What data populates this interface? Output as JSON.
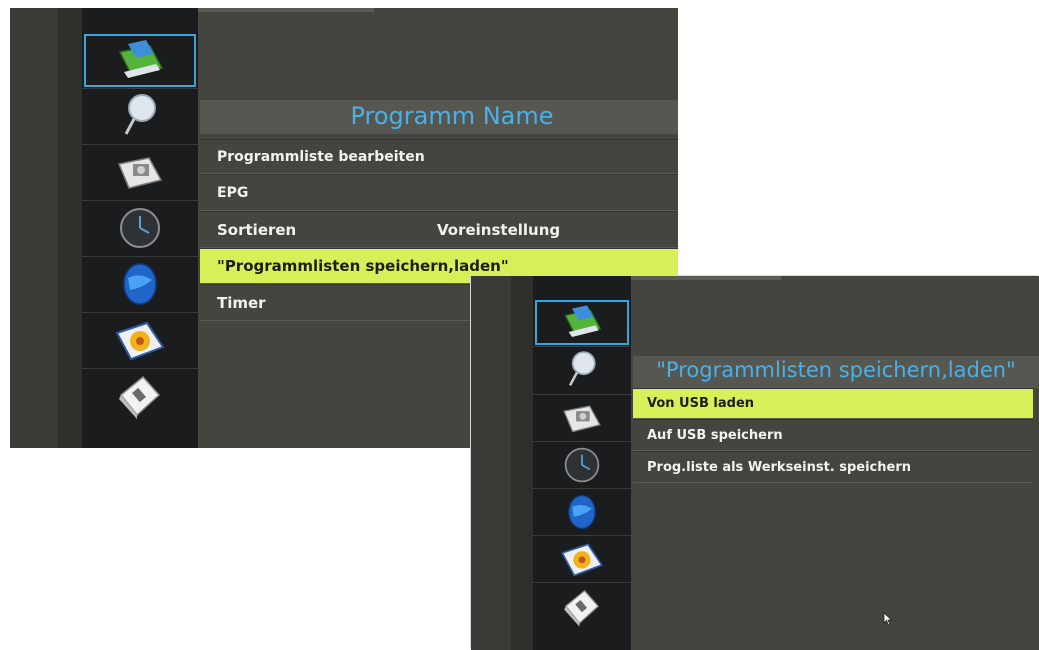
{
  "screen1": {
    "title": "Programm Name",
    "items": [
      {
        "label": "Programmliste bearbeiten",
        "value": ""
      },
      {
        "label": "EPG",
        "value": ""
      },
      {
        "label": "Sortieren",
        "value": "Voreinstellung"
      },
      {
        "label": "\"Programmlisten speichern,laden\"",
        "value": ""
      },
      {
        "label": "Timer",
        "value": ""
      }
    ],
    "selected_index": 3
  },
  "screen2": {
    "title": "\"Programmlisten speichern,laden\"",
    "items": [
      {
        "label": "Von USB laden"
      },
      {
        "label": "Auf USB speichern"
      },
      {
        "label": "Prog.liste als Werkseinst. speichern"
      }
    ],
    "selected_index": 0
  },
  "sidebar_icons": [
    "channel-settings-icon",
    "search-icon",
    "picture-settings-icon",
    "time-icon",
    "network-globe-icon",
    "options-flower-icon",
    "media-usb-icon"
  ],
  "colors": {
    "accent_blue": "#4cb0e8",
    "highlight": "#d8ef5a",
    "panel": "#44453f",
    "sidebar": "#1b1c1d"
  }
}
